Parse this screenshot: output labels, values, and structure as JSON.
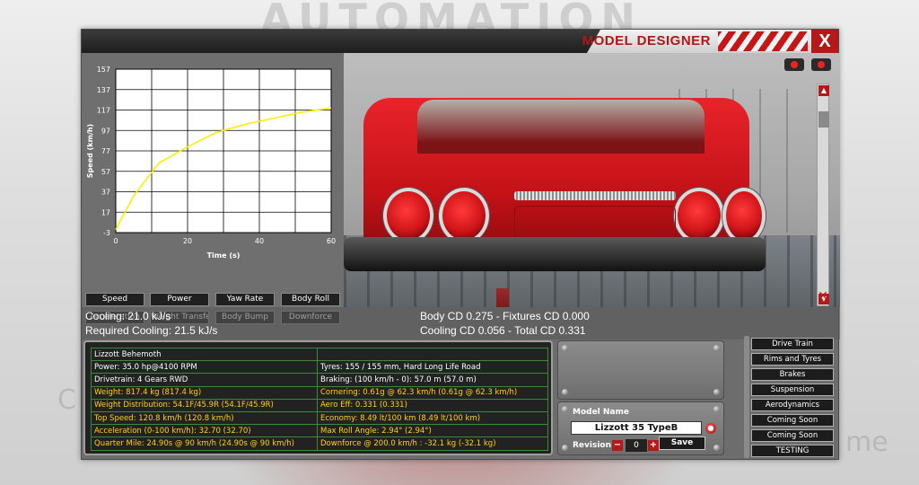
{
  "background": {
    "logo_text": "AUTOMATION",
    "ghost_left": "C O",
    "ghost_right": "me"
  },
  "window": {
    "title": "MODEL DESIGNER",
    "close_label": "X"
  },
  "chart_data": {
    "type": "line",
    "title": "",
    "xlabel": "Time (s)",
    "ylabel": "Speed (km/h)",
    "xlim": [
      0,
      60
    ],
    "ylim": [
      -3,
      157
    ],
    "x_ticks": [
      0,
      20,
      40,
      60
    ],
    "y_ticks": [
      -3,
      17,
      37,
      57,
      77,
      97,
      117,
      137,
      157
    ],
    "grid": true,
    "series": [
      {
        "color": "#ffee00",
        "x": [
          0,
          5,
          12,
          20,
          28,
          36,
          44,
          52,
          60
        ],
        "y": [
          0,
          33,
          65,
          81,
          95,
          103,
          109,
          115,
          119
        ]
      }
    ]
  },
  "graph_buttons": [
    "Speed",
    "Power",
    "Yaw Rate",
    "Body Roll",
    "Acceleration",
    "Weight Transfer",
    "Body Bump",
    "Downforce"
  ],
  "info": {
    "cooling": "Cooling: 21.0 kJ/s",
    "required_cooling": "Required Cooling: 21.5 kJ/s",
    "body_cd": "Body CD 0.275 - Fixtures CD 0.000",
    "cooling_cd": "Cooling CD 0.056 - Total CD 0.331"
  },
  "stats": {
    "rows": [
      [
        "Lizzott Behemoth",
        "",
        false
      ],
      [
        "Power: 35.0 hp@4100 RPM",
        "Tyres: 155 / 155 mm, Hard Long Life Road",
        false
      ],
      [
        "Drivetrain: 4 Gears RWD",
        "Braking: (100 km/h - 0): 57.0 m (57.0 m)",
        false
      ],
      [
        "Weight: 817.4 kg (817.4 kg)",
        "Cornering: 0.61g @ 62.3 km/h (0.61g @ 62.3 km/h)",
        true
      ],
      [
        "Weight Distribution: 54.1F/45.9R (54.1F/45.9R)",
        "Aero Eff: 0.331 (0.331)",
        true
      ],
      [
        "Top Speed: 120.8 km/h (120.8 km/h)",
        "Economy: 8.49 lt/100 km (8.49 lt/100 km)",
        true
      ],
      [
        "Acceleration (0-100 km/h): 32.70 (32.70)",
        "Max Roll Angle: 2.94° (2.94°)",
        true
      ],
      [
        "Quarter Mile: 24.90s @ 90 km/h (24.90s @ 90 km/h)",
        "Downforce @ 200.0 km/h : -32.1 kg (-32.1 kg)",
        true
      ]
    ]
  },
  "model": {
    "name_label": "Model Name",
    "name_value": "Lizzott 35 TypeB",
    "revision_label": "Revision",
    "revision_value": "0",
    "minus": "−",
    "plus": "+",
    "save_label": "Save"
  },
  "side_menu": [
    "Drive Train",
    "Rims and Tyres",
    "Brakes",
    "Suspension",
    "Aerodynamics",
    "Coming Soon",
    "Coming Soon",
    "TESTING"
  ],
  "colors": {
    "accent_red": "#b41818",
    "stat_highlight": "#ffd400",
    "graph_line": "#ffee00"
  }
}
